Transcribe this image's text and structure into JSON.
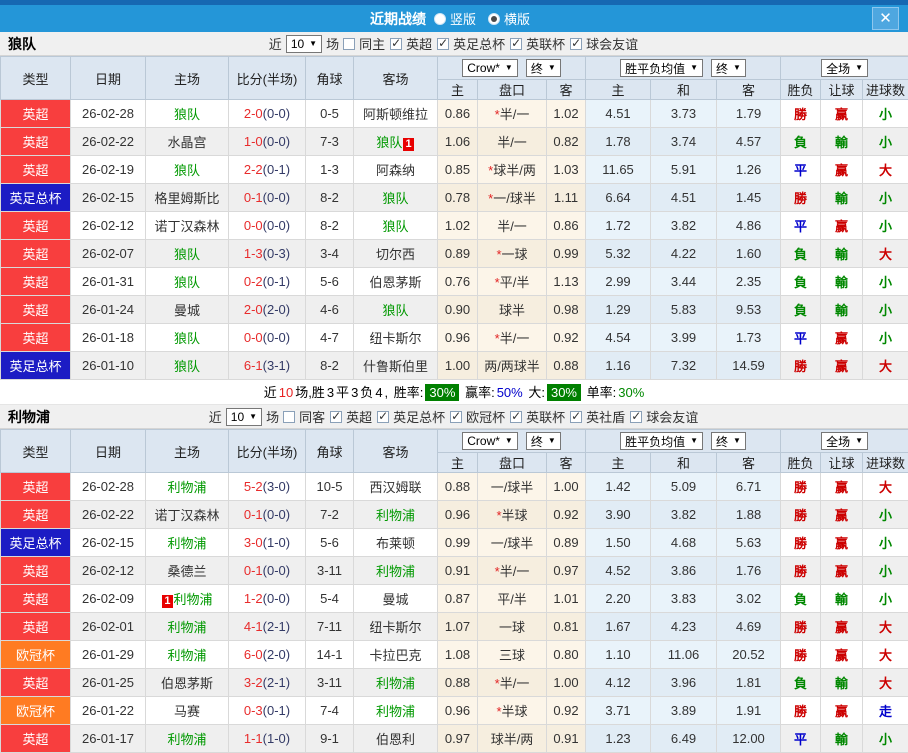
{
  "titlebar": {
    "title": "近期战绩",
    "vertical": "竖版",
    "horizontal": "横版",
    "close_glyph": "✕"
  },
  "controls": {
    "games": "10",
    "crown": "Crow*",
    "final": "终",
    "wdl_avg": "胜平负均值",
    "scope": "全场",
    "arrow": "▼"
  },
  "columns": {
    "type": "类型",
    "date": "日期",
    "home": "主场",
    "score": "比分(半场)",
    "corner": "角球",
    "away": "客场",
    "o_home": "主",
    "o_hcap": "盘口",
    "o_away": "客",
    "a_home": "主",
    "a_draw": "和",
    "a_away": "客",
    "wdl": "胜负",
    "hcap_res": "让球",
    "goals": "进球数"
  },
  "colors": {
    "epl_badge": "#f83e3e",
    "facup_badge": "#1c1cc4",
    "ucl_badge": "#ff7b22",
    "team_green": "#009900",
    "win_red": "#cc0000",
    "lose_green": "#008800",
    "draw_blue": "#0000cc",
    "titlebar_blue": "#2496d8",
    "badge_green": "#008000"
  },
  "sections": [
    {
      "team": "狼队",
      "filter": {
        "near": "近",
        "games": "10",
        "unit": "场",
        "same": "同主",
        "leagues": [
          "英超",
          "英足总杯",
          "英联杯",
          "球会友谊"
        ]
      },
      "rows": [
        {
          "lg": "epl",
          "league": "英超",
          "date": "26-02-28",
          "home": "狼队",
          "homeTeam": true,
          "homeBadge": "",
          "ft": "2-0",
          "ht": "(0-0)",
          "corner": "0-5",
          "away": "阿斯顿维拉",
          "awayTeam": false,
          "awayBadge": "",
          "o1": "0.86",
          "hc": "*半/一",
          "o2": "1.02",
          "a1": "4.51",
          "a2": "3.73",
          "a3": "1.79",
          "r1": "勝",
          "c1": "red",
          "r2": "赢",
          "c2": "red",
          "r3": "小",
          "c3": "green"
        },
        {
          "lg": "epl",
          "league": "英超",
          "date": "26-02-22",
          "home": "水晶宫",
          "homeTeam": false,
          "homeBadge": "",
          "ft": "1-0",
          "ht": "(0-0)",
          "corner": "7-3",
          "away": "狼队",
          "awayTeam": true,
          "awayBadge": "1",
          "o1": "1.06",
          "hc": "半/一",
          "o2": "0.82",
          "a1": "1.78",
          "a2": "3.74",
          "a3": "4.57",
          "r1": "負",
          "c1": "green",
          "r2": "輸",
          "c2": "green",
          "r3": "小",
          "c3": "green"
        },
        {
          "lg": "epl",
          "league": "英超",
          "date": "26-02-19",
          "home": "狼队",
          "homeTeam": true,
          "homeBadge": "",
          "ft": "2-2",
          "ht": "(0-1)",
          "corner": "1-3",
          "away": "阿森纳",
          "awayTeam": false,
          "awayBadge": "",
          "o1": "0.85",
          "hc": "*球半/两",
          "o2": "1.03",
          "a1": "11.65",
          "a2": "5.91",
          "a3": "1.26",
          "r1": "平",
          "c1": "blue",
          "r2": "赢",
          "c2": "red",
          "r3": "大",
          "c3": "red"
        },
        {
          "lg": "fa",
          "league": "英足总杯",
          "date": "26-02-15",
          "home": "格里姆斯比",
          "homeTeam": false,
          "homeBadge": "",
          "ft": "0-1",
          "ht": "(0-0)",
          "corner": "8-2",
          "away": "狼队",
          "awayTeam": true,
          "awayBadge": "",
          "o1": "0.78",
          "hc": "*一/球半",
          "o2": "1.11",
          "a1": "6.64",
          "a2": "4.51",
          "a3": "1.45",
          "r1": "勝",
          "c1": "red",
          "r2": "輸",
          "c2": "green",
          "r3": "小",
          "c3": "green"
        },
        {
          "lg": "epl",
          "league": "英超",
          "date": "26-02-12",
          "home": "诺丁汉森林",
          "homeTeam": false,
          "homeBadge": "",
          "ft": "0-0",
          "ht": "(0-0)",
          "corner": "8-2",
          "away": "狼队",
          "awayTeam": true,
          "awayBadge": "",
          "o1": "1.02",
          "hc": "半/一",
          "o2": "0.86",
          "a1": "1.72",
          "a2": "3.82",
          "a3": "4.86",
          "r1": "平",
          "c1": "blue",
          "r2": "赢",
          "c2": "red",
          "r3": "小",
          "c3": "green"
        },
        {
          "lg": "epl",
          "league": "英超",
          "date": "26-02-07",
          "home": "狼队",
          "homeTeam": true,
          "homeBadge": "",
          "ft": "1-3",
          "ht": "(0-3)",
          "corner": "3-4",
          "away": "切尔西",
          "awayTeam": false,
          "awayBadge": "",
          "o1": "0.89",
          "hc": "*一球",
          "o2": "0.99",
          "a1": "5.32",
          "a2": "4.22",
          "a3": "1.60",
          "r1": "負",
          "c1": "green",
          "r2": "輸",
          "c2": "green",
          "r3": "大",
          "c3": "red"
        },
        {
          "lg": "epl",
          "league": "英超",
          "date": "26-01-31",
          "home": "狼队",
          "homeTeam": true,
          "homeBadge": "",
          "ft": "0-2",
          "ht": "(0-1)",
          "corner": "5-6",
          "away": "伯恩茅斯",
          "awayTeam": false,
          "awayBadge": "",
          "o1": "0.76",
          "hc": "*平/半",
          "o2": "1.13",
          "a1": "2.99",
          "a2": "3.44",
          "a3": "2.35",
          "r1": "負",
          "c1": "green",
          "r2": "輸",
          "c2": "green",
          "r3": "小",
          "c3": "green"
        },
        {
          "lg": "epl",
          "league": "英超",
          "date": "26-01-24",
          "home": "曼城",
          "homeTeam": false,
          "homeBadge": "",
          "ft": "2-0",
          "ht": "(2-0)",
          "corner": "4-6",
          "away": "狼队",
          "awayTeam": true,
          "awayBadge": "",
          "o1": "0.90",
          "hc": "球半",
          "o2": "0.98",
          "a1": "1.29",
          "a2": "5.83",
          "a3": "9.53",
          "r1": "負",
          "c1": "green",
          "r2": "輸",
          "c2": "green",
          "r3": "小",
          "c3": "green"
        },
        {
          "lg": "epl",
          "league": "英超",
          "date": "26-01-18",
          "home": "狼队",
          "homeTeam": true,
          "homeBadge": "",
          "ft": "0-0",
          "ht": "(0-0)",
          "corner": "4-7",
          "away": "纽卡斯尔",
          "awayTeam": false,
          "awayBadge": "",
          "o1": "0.96",
          "hc": "*半/一",
          "o2": "0.92",
          "a1": "4.54",
          "a2": "3.99",
          "a3": "1.73",
          "r1": "平",
          "c1": "blue",
          "r2": "赢",
          "c2": "red",
          "r3": "小",
          "c3": "green"
        },
        {
          "lg": "fa",
          "league": "英足总杯",
          "date": "26-01-10",
          "home": "狼队",
          "homeTeam": true,
          "homeBadge": "",
          "ft": "6-1",
          "ht": "(3-1)",
          "corner": "8-2",
          "away": "什鲁斯伯里",
          "awayTeam": false,
          "awayBadge": "",
          "o1": "1.00",
          "hc": "两/两球半",
          "o2": "0.88",
          "a1": "1.16",
          "a2": "7.32",
          "a3": "14.59",
          "r1": "勝",
          "c1": "red",
          "r2": "赢",
          "c2": "red",
          "r3": "大",
          "c3": "red"
        }
      ],
      "summary": {
        "pre": "近",
        "count": "10",
        "mid": "场,胜",
        "w": "3",
        "p": "平",
        "d": "3",
        "f": "负",
        "l": "4",
        "sep": ", ",
        "rate_label": "胜率:",
        "rate": "30%",
        "profit_label": "赢率:",
        "profit": "50%",
        "big_label": "大:",
        "big": "30%",
        "single_label": "单率:",
        "single": "30%"
      }
    },
    {
      "team": "利物浦",
      "filter": {
        "near": "近",
        "games": "10",
        "unit": "场",
        "same": "同客",
        "leagues": [
          "英超",
          "英足总杯",
          "欧冠杯",
          "英联杯",
          "英社盾",
          "球会友谊"
        ]
      },
      "rows": [
        {
          "lg": "epl",
          "league": "英超",
          "date": "26-02-28",
          "home": "利物浦",
          "homeTeam": true,
          "homeBadge": "",
          "ft": "5-2",
          "ht": "(3-0)",
          "corner": "10-5",
          "away": "西汉姆联",
          "awayTeam": false,
          "awayBadge": "",
          "o1": "0.88",
          "hc": "一/球半",
          "o2": "1.00",
          "a1": "1.42",
          "a2": "5.09",
          "a3": "6.71",
          "r1": "勝",
          "c1": "red",
          "r2": "赢",
          "c2": "red",
          "r3": "大",
          "c3": "red"
        },
        {
          "lg": "epl",
          "league": "英超",
          "date": "26-02-22",
          "home": "诺丁汉森林",
          "homeTeam": false,
          "homeBadge": "",
          "ft": "0-1",
          "ht": "(0-0)",
          "corner": "7-2",
          "away": "利物浦",
          "awayTeam": true,
          "awayBadge": "",
          "o1": "0.96",
          "hc": "*半球",
          "o2": "0.92",
          "a1": "3.90",
          "a2": "3.82",
          "a3": "1.88",
          "r1": "勝",
          "c1": "red",
          "r2": "赢",
          "c2": "red",
          "r3": "小",
          "c3": "green"
        },
        {
          "lg": "fa",
          "league": "英足总杯",
          "date": "26-02-15",
          "home": "利物浦",
          "homeTeam": true,
          "homeBadge": "",
          "ft": "3-0",
          "ht": "(1-0)",
          "corner": "5-6",
          "away": "布莱顿",
          "awayTeam": false,
          "awayBadge": "",
          "o1": "0.99",
          "hc": "一/球半",
          "o2": "0.89",
          "a1": "1.50",
          "a2": "4.68",
          "a3": "5.63",
          "r1": "勝",
          "c1": "red",
          "r2": "赢",
          "c2": "red",
          "r3": "小",
          "c3": "green"
        },
        {
          "lg": "epl",
          "league": "英超",
          "date": "26-02-12",
          "home": "桑德兰",
          "homeTeam": false,
          "homeBadge": "",
          "ft": "0-1",
          "ht": "(0-0)",
          "corner": "3-11",
          "away": "利物浦",
          "awayTeam": true,
          "awayBadge": "",
          "o1": "0.91",
          "hc": "*半/一",
          "o2": "0.97",
          "a1": "4.52",
          "a2": "3.86",
          "a3": "1.76",
          "r1": "勝",
          "c1": "red",
          "r2": "赢",
          "c2": "red",
          "r3": "小",
          "c3": "green"
        },
        {
          "lg": "epl",
          "league": "英超",
          "date": "26-02-09",
          "home": "利物浦",
          "homeTeam": true,
          "homeBadge": "1",
          "ft": "1-2",
          "ht": "(0-0)",
          "corner": "5-4",
          "away": "曼城",
          "awayTeam": false,
          "awayBadge": "",
          "o1": "0.87",
          "hc": "平/半",
          "o2": "1.01",
          "a1": "2.20",
          "a2": "3.83",
          "a3": "3.02",
          "r1": "負",
          "c1": "green",
          "r2": "輸",
          "c2": "green",
          "r3": "小",
          "c3": "green"
        },
        {
          "lg": "epl",
          "league": "英超",
          "date": "26-02-01",
          "home": "利物浦",
          "homeTeam": true,
          "homeBadge": "",
          "ft": "4-1",
          "ht": "(2-1)",
          "corner": "7-11",
          "away": "纽卡斯尔",
          "awayTeam": false,
          "awayBadge": "",
          "o1": "1.07",
          "hc": "一球",
          "o2": "0.81",
          "a1": "1.67",
          "a2": "4.23",
          "a3": "4.69",
          "r1": "勝",
          "c1": "red",
          "r2": "赢",
          "c2": "red",
          "r3": "大",
          "c3": "red"
        },
        {
          "lg": "ucl",
          "league": "欧冠杯",
          "date": "26-01-29",
          "home": "利物浦",
          "homeTeam": true,
          "homeBadge": "",
          "ft": "6-0",
          "ht": "(2-0)",
          "corner": "14-1",
          "away": "卡拉巴克",
          "awayTeam": false,
          "awayBadge": "",
          "o1": "1.08",
          "hc": "三球",
          "o2": "0.80",
          "a1": "1.10",
          "a2": "11.06",
          "a3": "20.52",
          "r1": "勝",
          "c1": "red",
          "r2": "赢",
          "c2": "red",
          "r3": "大",
          "c3": "red"
        },
        {
          "lg": "epl",
          "league": "英超",
          "date": "26-01-25",
          "home": "伯恩茅斯",
          "homeTeam": false,
          "homeBadge": "",
          "ft": "3-2",
          "ht": "(2-1)",
          "corner": "3-11",
          "away": "利物浦",
          "awayTeam": true,
          "awayBadge": "",
          "o1": "0.88",
          "hc": "*半/一",
          "o2": "1.00",
          "a1": "4.12",
          "a2": "3.96",
          "a3": "1.81",
          "r1": "負",
          "c1": "green",
          "r2": "輸",
          "c2": "green",
          "r3": "大",
          "c3": "red"
        },
        {
          "lg": "ucl",
          "league": "欧冠杯",
          "date": "26-01-22",
          "home": "马赛",
          "homeTeam": false,
          "homeBadge": "",
          "ft": "0-3",
          "ht": "(0-1)",
          "corner": "7-4",
          "away": "利物浦",
          "awayTeam": true,
          "awayBadge": "",
          "o1": "0.96",
          "hc": "*半球",
          "o2": "0.92",
          "a1": "3.71",
          "a2": "3.89",
          "a3": "1.91",
          "r1": "勝",
          "c1": "red",
          "r2": "赢",
          "c2": "red",
          "r3": "走",
          "c3": "blue"
        },
        {
          "lg": "epl",
          "league": "英超",
          "date": "26-01-17",
          "home": "利物浦",
          "homeTeam": true,
          "homeBadge": "",
          "ft": "1-1",
          "ht": "(1-0)",
          "corner": "9-1",
          "away": "伯恩利",
          "awayTeam": false,
          "awayBadge": "",
          "o1": "0.97",
          "hc": "球半/两",
          "o2": "0.91",
          "a1": "1.23",
          "a2": "6.49",
          "a3": "12.00",
          "r1": "平",
          "c1": "blue",
          "r2": "輸",
          "c2": "green",
          "r3": "小",
          "c3": "green"
        }
      ]
    }
  ]
}
